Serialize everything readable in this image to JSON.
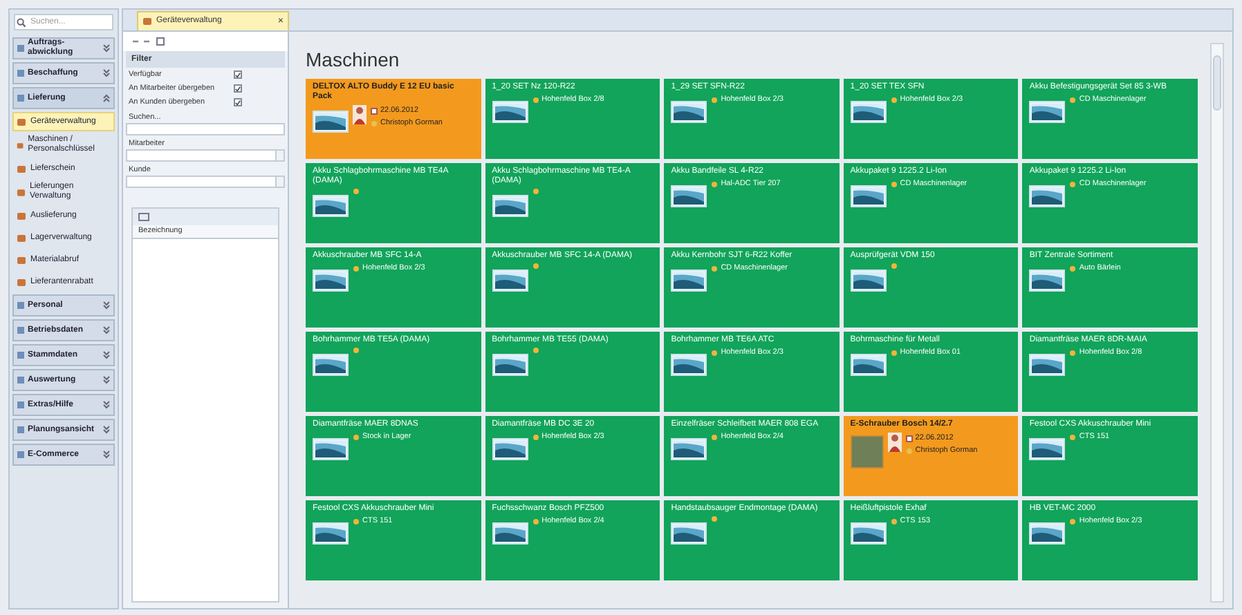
{
  "sidebar": {
    "search": {
      "placeholder": "Suchen..."
    },
    "groups": [
      {
        "label": "Auftrags-abwicklung",
        "expanded": false
      },
      {
        "label": "Beschaffung",
        "expanded": false
      },
      {
        "label": "Lieferung",
        "expanded": true,
        "items": [
          {
            "label": "Geräteverwaltung",
            "selected": true
          },
          {
            "label": "Maschinen / Personalschlüssel",
            "selected": false
          },
          {
            "label": "Lieferschein",
            "selected": false
          },
          {
            "label": "Lieferungen Verwaltung",
            "selected": false
          },
          {
            "label": "Auslieferung",
            "selected": false
          },
          {
            "label": "Lagerverwaltung",
            "selected": false
          },
          {
            "label": "Materialabruf",
            "selected": false
          },
          {
            "label": "Lieferantenrabatt",
            "selected": false
          }
        ]
      },
      {
        "label": "Personal",
        "expanded": false
      },
      {
        "label": "Betriebsdaten",
        "expanded": false
      },
      {
        "label": "Stammdaten",
        "expanded": false
      },
      {
        "label": "Auswertung",
        "expanded": false
      },
      {
        "label": "Extras/Hilfe",
        "expanded": false
      },
      {
        "label": "Planungsansicht",
        "expanded": false
      },
      {
        "label": "E-Commerce",
        "expanded": false
      }
    ]
  },
  "tab": {
    "label": "Geräteverwaltung",
    "close": "×"
  },
  "filter": {
    "title": "Filter",
    "checks": [
      {
        "label": "Verfügbar",
        "checked": true
      },
      {
        "label": "An Mitarbeiter übergeben",
        "checked": true
      },
      {
        "label": "An Kunden übergeben",
        "checked": true
      }
    ],
    "search_label": "Suchen...",
    "employee_label": "Mitarbeiter",
    "customer_label": "Kunde",
    "list_column": "Bezeichnung"
  },
  "main": {
    "title": "Maschinen",
    "tiles": [
      {
        "kind": "assigned",
        "name": "DELTOX ALTO Buddy E 12 EU basic Pack",
        "date": "22.06.2012",
        "person": "Christoph Gorman"
      },
      {
        "kind": "available",
        "name": "1_20 SET Nz 120-R22",
        "location": "Hohenfeld Box 2/8"
      },
      {
        "kind": "available",
        "name": "1_29 SET SFN-R22",
        "location": "Hohenfeld Box 2/3"
      },
      {
        "kind": "available",
        "name": "1_20 SET TEX SFN",
        "location": "Hohenfeld Box 2/3"
      },
      {
        "kind": "available",
        "name": "Akku Befestigungsgerät Set 85 3-WB",
        "location": "CD Maschinenlager"
      },
      {
        "kind": "available",
        "name": "Akku Schlagbohrmaschine MB TE4A (DAMA)"
      },
      {
        "kind": "available",
        "name": "Akku Schlagbohrmaschine MB TE4-A (DAMA)"
      },
      {
        "kind": "available",
        "name": "Akku Bandfeile SL 4-R22",
        "location": "Hal-ADC Tier 207"
      },
      {
        "kind": "available",
        "name": "Akkupaket 9 1225.2 Li-Ion",
        "location": "CD Maschinenlager"
      },
      {
        "kind": "available",
        "name": "Akkupaket 9 1225.2 Li-Ion",
        "location": "CD Maschinenlager"
      },
      {
        "kind": "available",
        "name": "Akkuschrauber MB SFC 14-A",
        "location": "Hohenfeld Box 2/3"
      },
      {
        "kind": "available",
        "name": "Akkuschrauber MB SFC 14-A (DAMA)"
      },
      {
        "kind": "available",
        "name": "Akku Kernbohr SJT 6-R22 Koffer",
        "location": "CD Maschinenlager"
      },
      {
        "kind": "available",
        "name": "Ausprüfgerät VDM 150"
      },
      {
        "kind": "available",
        "name": "BIT Zentrale Sortiment",
        "location": "Auto Bärlein"
      },
      {
        "kind": "available",
        "name": "Bohrhammer MB TE5A (DAMA)"
      },
      {
        "kind": "available",
        "name": "Bohrhammer MB TE55 (DAMA)"
      },
      {
        "kind": "available",
        "name": "Bohrhammer MB TE6A ATC",
        "location": "Hohenfeld Box 2/3"
      },
      {
        "kind": "available",
        "name": "Bohrmaschine für Metall",
        "location": "Hohenfeld Box 01"
      },
      {
        "kind": "available",
        "name": "Diamantfräse MAER 8DR-MAIA",
        "location": "Hohenfeld Box 2/8"
      },
      {
        "kind": "available",
        "name": "Diamantfräse MAER 8DNAS",
        "location": "Stock in Lager"
      },
      {
        "kind": "available",
        "name": "Diamantfräse MB DC 3E 20",
        "location": "Hohenfeld Box 2/3"
      },
      {
        "kind": "available",
        "name": "Einzelfräser Schleifbett MAER 808 EGA",
        "location": "Hohenfeld Box 2/4"
      },
      {
        "kind": "assigned",
        "name": "E-Schrauber Bosch 14/2.7",
        "date": "22.06.2012",
        "person": "Christoph Gorman",
        "photo": true
      },
      {
        "kind": "available",
        "name": "Festool CXS Akkuschrauber Mini",
        "location": "CTS 151"
      },
      {
        "kind": "available",
        "name": "Festool CXS Akkuschrauber Mini",
        "location": "CTS 151"
      },
      {
        "kind": "available",
        "name": "Fuchsschwanz Bosch PFZ500",
        "location": "Hohenfeld Box 2/4"
      },
      {
        "kind": "available",
        "name": "Handstaubsauger Endmontage (DAMA)"
      },
      {
        "kind": "available",
        "name": "Heißluftpistole Exhaf",
        "location": "CTS 153"
      },
      {
        "kind": "available",
        "name": "HB VET-MC 2000",
        "location": "Hohenfeld Box 2/3"
      }
    ]
  }
}
